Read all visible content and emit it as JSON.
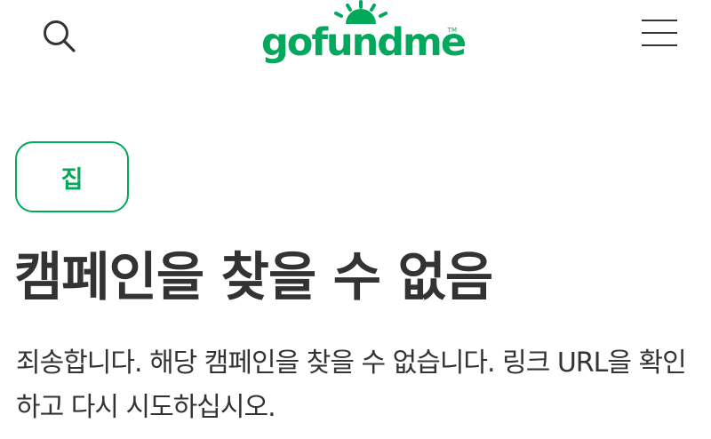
{
  "header": {
    "logo_text": "gofundme",
    "logo_tm": "TM",
    "icons": {
      "search": "search-icon",
      "menu": "hamburger-menu-icon",
      "logo_sun": "sun-rays-icon"
    }
  },
  "main": {
    "home_button_label": "집",
    "title": "캠페인을 찾을 수 없음",
    "message": "죄송합니다. 해당 캠페인을 찾을 수 없습니다. 링크 URL을 확인하고 다시 시도하십시오."
  },
  "colors": {
    "brand_green": "#02a95c",
    "text": "#333333",
    "background": "#ffffff"
  }
}
